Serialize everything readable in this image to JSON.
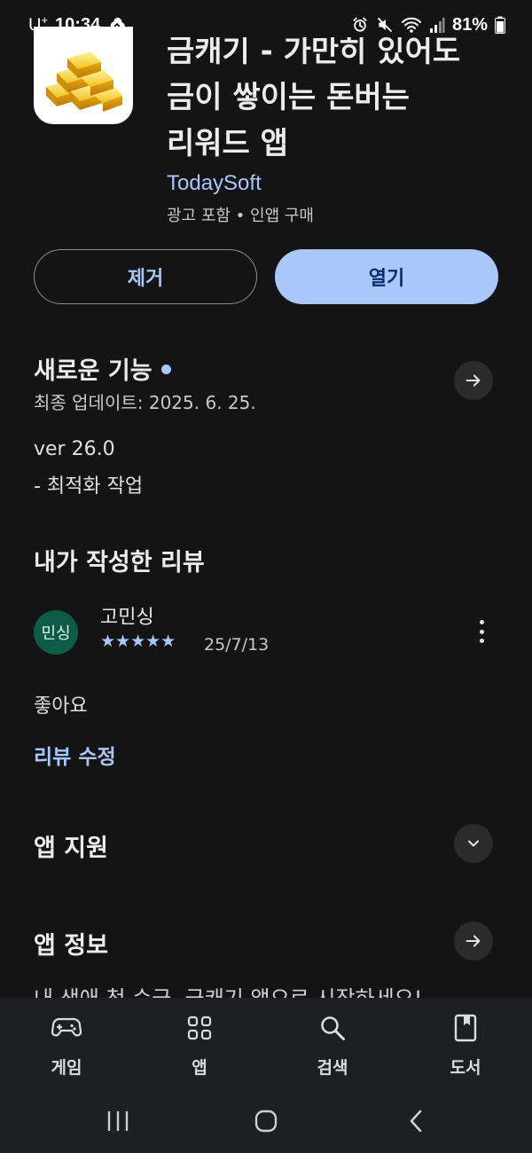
{
  "status_bar": {
    "carrier": "U",
    "carrier_sup": "+",
    "time": "10:34",
    "battery": "81%"
  },
  "app": {
    "title": "금캐기 - 가만히 있어도\n금이 쌓이는 돈버는\n리워드 앱",
    "developer": "TodaySoft",
    "meta": "광고 포함 • 인앱 구매"
  },
  "actions": {
    "remove_label": "제거",
    "open_label": "열기"
  },
  "whats_new": {
    "title": "새로운 기능",
    "last_updated": "최종 업데이트: 2025. 6. 25.",
    "version": "ver 26.0",
    "notes": "- 최적화 작업"
  },
  "my_review": {
    "title": "내가 작성한 리뷰",
    "avatar_text": "민싱",
    "reviewer": "고민싱",
    "rating": 5,
    "stars": "★★★★★",
    "date": "25/7/13",
    "text": "좋아요",
    "edit_label": "리뷰 수정"
  },
  "app_support": {
    "title": "앱 지원"
  },
  "app_info": {
    "title": "앱 정보",
    "description_cutoff": "내 생애 첫 순금, 금캐기 앱으로 시작하세요!"
  },
  "bottom_nav": {
    "items": [
      {
        "label": "게임",
        "icon": "gamepad-icon"
      },
      {
        "label": "앱",
        "icon": "apps-grid-icon"
      },
      {
        "label": "검색",
        "icon": "search-icon"
      },
      {
        "label": "도서",
        "icon": "book-icon"
      }
    ]
  },
  "colors": {
    "background": "#141414",
    "accent": "#a8c7fa",
    "open_button_text": "#062e6f",
    "avatar_bg": "#0d5c4a"
  }
}
